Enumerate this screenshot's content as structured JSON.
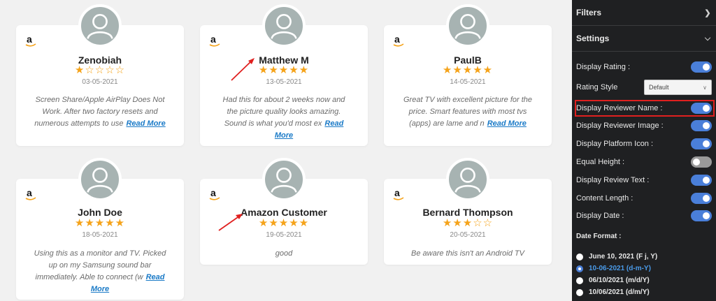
{
  "reviews": [
    {
      "name": "Zenobiah",
      "rating": 1,
      "date": "03-05-2021",
      "text": "Screen Share/Apple AirPlay Does Not Work. After two factory resets and numerous attempts to use",
      "read_more": "Read More"
    },
    {
      "name": "Matthew M",
      "rating": 5,
      "date": "13-05-2021",
      "text": "Had this for about 2 weeks now and the picture quality looks amazing. Sound is what you'd most ex",
      "read_more": "Read More"
    },
    {
      "name": "PaulB",
      "rating": 5,
      "date": "14-05-2021",
      "text": "Great TV with excellent picture for the price. Smart features with most tvs (apps) are lame and n",
      "read_more": "Read More"
    },
    {
      "name": "John Doe",
      "rating": 5,
      "date": "18-05-2021",
      "text": "Using this as a monitor and TV. Picked up on my Samsung sound bar immediately. Able to connect (w",
      "read_more": "Read More"
    },
    {
      "name": "Amazon Customer",
      "rating": 5,
      "date": "19-05-2021",
      "text": "good",
      "read_more": ""
    },
    {
      "name": "Bernard Thompson",
      "rating": 3,
      "date": "20-05-2021",
      "text": "Be aware this isn't an Android TV",
      "read_more": ""
    }
  ],
  "sidebar": {
    "filters_label": "Filters",
    "settings_label": "Settings",
    "display_rating": "Display Rating :",
    "rating_style": "Rating Style",
    "rating_style_value": "Default",
    "display_reviewer_name": "Display Reviewer Name :",
    "display_reviewer_image": "Display Reviewer Image :",
    "display_platform_icon": "Display Platform Icon :",
    "equal_height": "Equal Height :",
    "display_review_text": "Display Review Text :",
    "content_length": "Content Length :",
    "display_date": "Display Date :",
    "date_format": "Date Format :",
    "date_options": [
      "June 10, 2021 (F j, Y)",
      "10-06-2021 (d-m-Y)",
      "06/10/2021 (m/d/Y)",
      "10/06/2021 (d/m/Y)"
    ],
    "selected_date_option": 1
  },
  "colors": {
    "accent": "#4a7fd9",
    "star": "#f5a31a",
    "link": "#1a7ac7",
    "highlight": "#e0201f"
  }
}
